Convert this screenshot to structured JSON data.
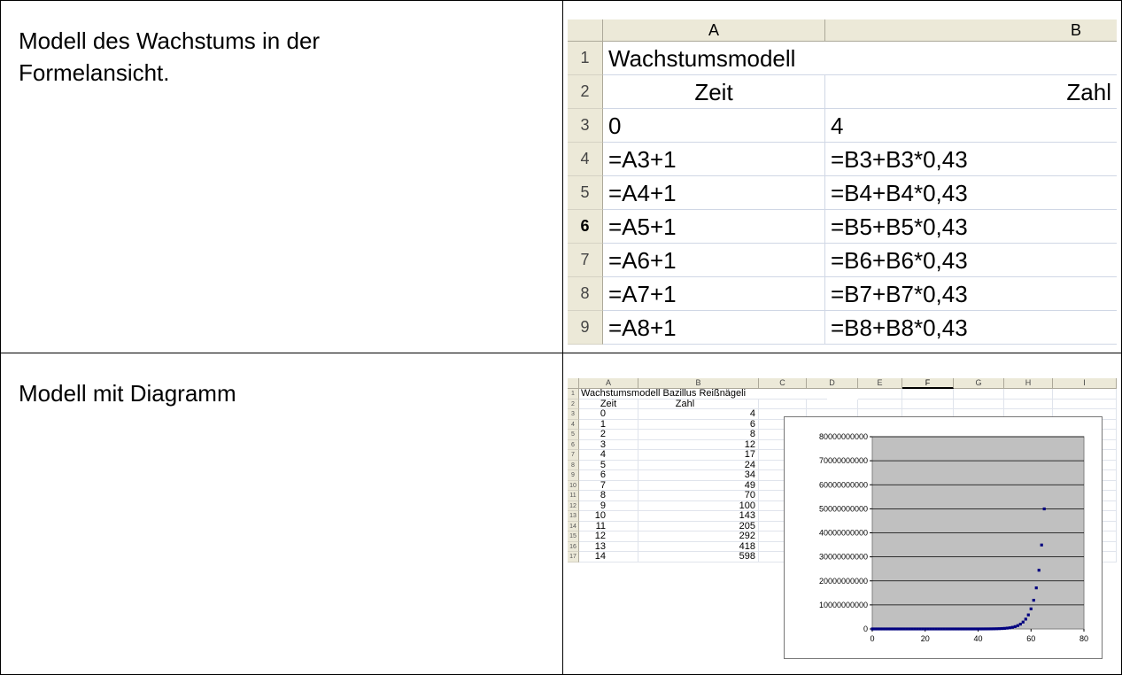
{
  "rows": [
    {
      "label": "Modell des Wachstums in der Formelansicht."
    },
    {
      "label": "Modell mit Diagramm"
    }
  ],
  "formula_sheet": {
    "columns": [
      "A",
      "B"
    ],
    "row_numbers": [
      "1",
      "2",
      "3",
      "4",
      "5",
      "6",
      "7",
      "8",
      "9"
    ],
    "cells": [
      [
        "Wachstumsmodell",
        ""
      ],
      [
        "Zeit",
        "Zahl"
      ],
      [
        "0",
        "4"
      ],
      [
        "=A3+1",
        "=B3+B3*0,43"
      ],
      [
        "=A4+1",
        "=B4+B4*0,43"
      ],
      [
        "=A5+1",
        "=B5+B5*0,43"
      ],
      [
        "=A6+1",
        "=B6+B6*0,43"
      ],
      [
        "=A7+1",
        "=B7+B7*0,43"
      ],
      [
        "=A8+1",
        "=B8+B8*0,43"
      ]
    ]
  },
  "chart_sheet": {
    "columns": [
      "A",
      "B",
      "C",
      "D",
      "E",
      "F",
      "G",
      "H",
      "I"
    ],
    "row_numbers": [
      "1",
      "2",
      "3",
      "4",
      "5",
      "6",
      "7",
      "8",
      "9",
      "10",
      "11",
      "12",
      "13",
      "14",
      "15",
      "16",
      "17"
    ],
    "title": "Wachstumsmodell Bazillus Reißnägeli",
    "header_zeit": "Zeit",
    "header_zahl": "Zahl",
    "zeit": [
      "0",
      "1",
      "2",
      "3",
      "4",
      "5",
      "6",
      "7",
      "8",
      "9",
      "10",
      "11",
      "12",
      "13",
      "14"
    ],
    "zahl": [
      "4",
      "6",
      "8",
      "12",
      "17",
      "24",
      "34",
      "49",
      "70",
      "100",
      "143",
      "205",
      "292",
      "418",
      "598"
    ]
  },
  "chart_data": {
    "type": "scatter",
    "title": "",
    "xlabel": "",
    "ylabel": "",
    "xlim": [
      0,
      80
    ],
    "ylim": [
      0,
      80000000000
    ],
    "x_ticks": [
      "0",
      "20",
      "40",
      "60",
      "80"
    ],
    "y_ticks": [
      "0",
      "10000000000",
      "20000000000",
      "30000000000",
      "40000000000",
      "50000000000",
      "60000000000",
      "70000000000",
      "80000000000"
    ],
    "grid": true,
    "legend": "none",
    "marker_color": "#00007f",
    "plot_background": "#c0c0c0",
    "series": [
      {
        "x": [
          0,
          1,
          2,
          3,
          4,
          5,
          6,
          7,
          8,
          9,
          10,
          11,
          12,
          13,
          14,
          15,
          16,
          17,
          18,
          19,
          20,
          21,
          22,
          23,
          24,
          25,
          26,
          27,
          28,
          29,
          30,
          31,
          32,
          33,
          34,
          35,
          36,
          37,
          38,
          39,
          40,
          41,
          42,
          43,
          44,
          45,
          46,
          47,
          48,
          49,
          50,
          51,
          52,
          53,
          54,
          55,
          56,
          57,
          58,
          59,
          60,
          61,
          62,
          63,
          64,
          65
        ],
        "y": [
          4,
          6,
          8,
          12,
          17,
          24,
          34,
          49,
          70,
          100,
          143,
          205,
          292,
          418,
          598,
          855,
          1222,
          1748,
          2499,
          3574,
          5111,
          7309,
          10451,
          14945,
          21372,
          30562,
          43703,
          62495,
          89368,
          127796,
          182748,
          261330,
          373701,
          534392,
          764180,
          1092778,
          1562673,
          2234622,
          3195510,
          4569580,
          6534500,
          9344334,
          13362398,
          19108229,
          27324768,
          39074418,
          55876418,
          79903278,
          114261688,
          163394214,
          233653726,
          334124828,
          477798504,
          683251861,
          977050161,
          1397181730,
          1997969874,
          2857096920,
          4085648595,
          5842477491,
          8354742812,
          11947282221,
          17084613576,
          24430997414,
          34936326302,
          49958946612
        ]
      }
    ]
  }
}
